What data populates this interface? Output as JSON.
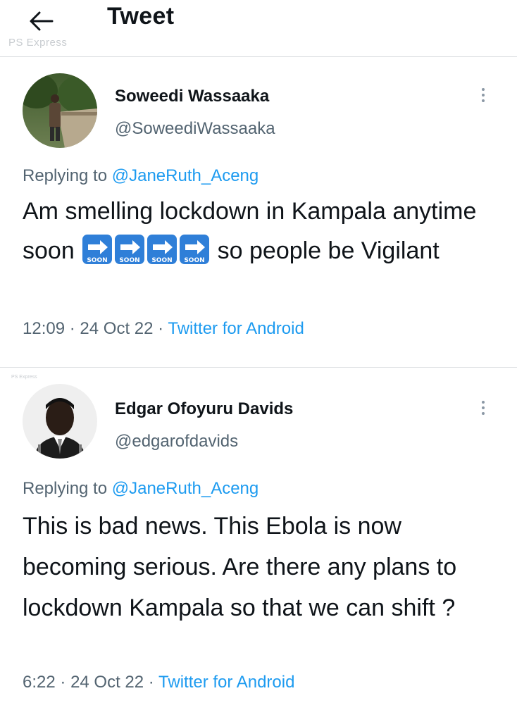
{
  "header": {
    "title": "Tweet",
    "back_icon": "arrow-left-icon",
    "watermark": "PS Express"
  },
  "tweets": [
    {
      "display_name": "Soweedi Wassaaka",
      "handle": "@SoweediWassaaka",
      "replying_prefix": "Replying to",
      "replying_to": "@JaneRuth_Aceng",
      "text_before": "Am smelling lockdown in Kampala anytime soon",
      "emoji": {
        "name": "soon-arrow-icon",
        "label": "SOON",
        "count": 4
      },
      "text_after": "so people be Vigilant",
      "time": "12:09",
      "date": "24 Oct 22",
      "source": "Twitter for Android",
      "more_icon": "more-vertical-icon"
    },
    {
      "display_name": "Edgar Ofoyuru Davids",
      "handle": "@edgarofdavids",
      "replying_prefix": "Replying to",
      "replying_to": "@JaneRuth_Aceng",
      "text": "This is bad news. This Ebola is now becoming serious.  Are there any plans to lockdown Kampala so that we can shift ?",
      "time": "6:22",
      "date": "24 Oct 22",
      "source": "Twitter for Android",
      "more_icon": "more-vertical-icon"
    }
  ],
  "meta_separator": "·",
  "colors": {
    "link": "#1d9bf0",
    "secondary_text": "#536471",
    "divider": "#dcdfe2",
    "soon_emoji_blue": "#2f7fd8"
  }
}
